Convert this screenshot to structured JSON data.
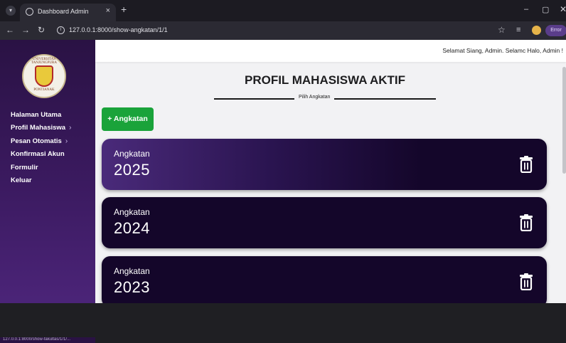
{
  "browser": {
    "tab_title": "Dashboard Admin",
    "tab_close": "×",
    "new_tab": "+",
    "url": "127.0.0.1:8000/show-angkatan/1/1",
    "error_badge": "Error",
    "status_url": "127.0.0.1:8000/show-fakultas/1/1/..."
  },
  "sidebar": {
    "logo_top_text": "UNIVERSITAS TANJUNGPURA",
    "logo_bottom_text": "PONTIANAK",
    "items": [
      {
        "label": "Halaman Utama",
        "has_chevron": false
      },
      {
        "label": "Profil Mahasiswa",
        "has_chevron": true
      },
      {
        "label": "Pesan Otomatis",
        "has_chevron": true
      },
      {
        "label": "Konfirmasi Akun",
        "has_chevron": false
      },
      {
        "label": "Formulir",
        "has_chevron": false
      },
      {
        "label": "Keluar",
        "has_chevron": false
      }
    ],
    "chevron": "›"
  },
  "header": {
    "greeting": "Selamat Siang, Admin. Selamc  Halo, Admin !"
  },
  "main": {
    "title": "PROFIL MAHASISWA AKTIF",
    "subtitle": "Pilih Angkatan",
    "add_button": "+ Angkatan",
    "cards": [
      {
        "label": "Angkatan",
        "year": "2025"
      },
      {
        "label": "Angkatan",
        "year": "2024"
      },
      {
        "label": "Angkatan",
        "year": "2023"
      }
    ]
  },
  "colors": {
    "sidebar_top": "#2a1244",
    "sidebar_bottom": "#4b2478",
    "card_dark": "#14062a",
    "card_highlight": "#4a2a7a",
    "add_button": "#1aa33a"
  },
  "icons": {
    "trash": "trash-icon",
    "star": "bookmark-star-icon"
  }
}
